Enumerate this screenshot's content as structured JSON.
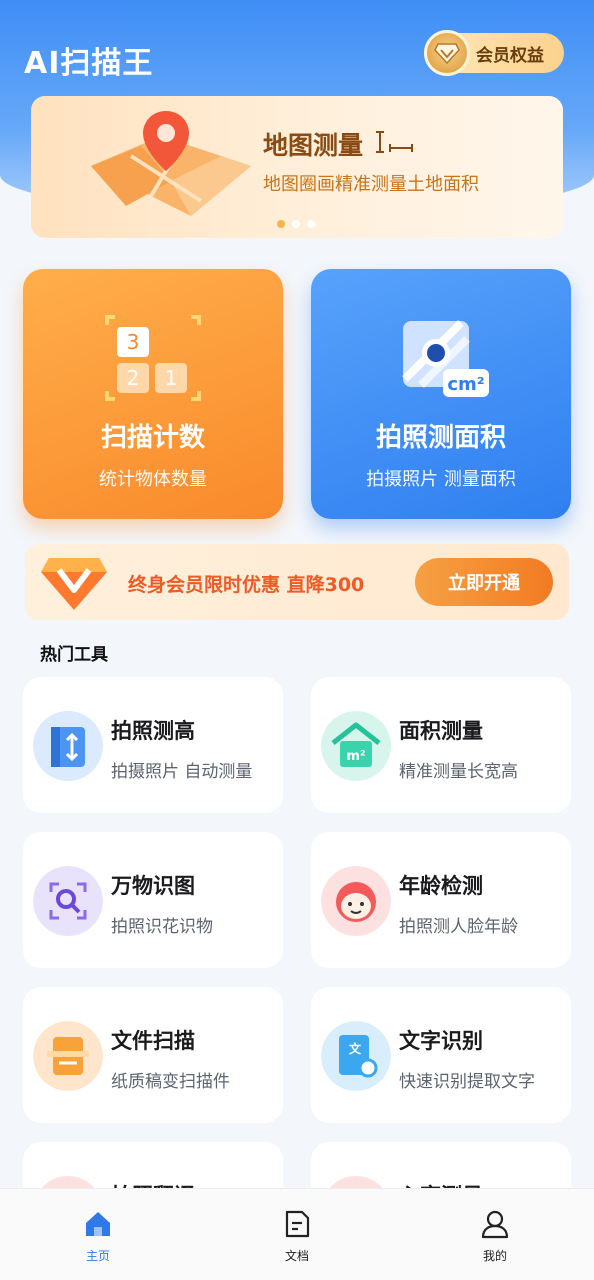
{
  "app": {
    "title": "AI扫描王"
  },
  "header": {
    "vip_label": "会员权益"
  },
  "banner": {
    "title": "地图测量",
    "subtitle": "地图圈画精准测量土地面积",
    "dot_count": 3,
    "active_dot": 0
  },
  "features": [
    {
      "title": "扫描计数",
      "subtitle": "统计物体数量",
      "icon": "counter-blocks-icon",
      "color": "#f98a2b"
    },
    {
      "title": "拍照测面积",
      "subtitle": "拍摄照片 测量面积",
      "icon": "area-measure-icon",
      "color": "#2f7ff0"
    }
  ],
  "promo": {
    "text": "终身会员限时优惠 直降300",
    "button": "立即开通"
  },
  "hot_tools": {
    "title": "热门工具",
    "items": [
      {
        "name": "拍照测高",
        "desc": "拍摄照片 自动测量",
        "icon": "height-ruler-icon"
      },
      {
        "name": "面积测量",
        "desc": "精准测量长宽高",
        "icon": "house-area-icon"
      },
      {
        "name": "万物识图",
        "desc": "拍照识花识物",
        "icon": "image-search-icon"
      },
      {
        "name": "年龄检测",
        "desc": "拍照测人脸年龄",
        "icon": "face-age-icon"
      },
      {
        "name": "文件扫描",
        "desc": "纸质稿变扫描件",
        "icon": "document-scan-icon"
      },
      {
        "name": "文字识别",
        "desc": "快速识别提取文字",
        "icon": "text-recognition-icon"
      },
      {
        "name": "拍照翻译",
        "desc": "",
        "icon": "translate-icon"
      },
      {
        "name": "心率测量",
        "desc": "",
        "icon": "heart-rate-icon"
      }
    ]
  },
  "tabbar": {
    "items": [
      {
        "label": "主页",
        "icon": "home-icon",
        "active": true
      },
      {
        "label": "文档",
        "icon": "document-icon",
        "active": false
      },
      {
        "label": "我的",
        "icon": "user-icon",
        "active": false
      }
    ]
  },
  "colors": {
    "primary": "#2f7ff0",
    "orange": "#f98a2b",
    "promo_text": "#f05a24"
  }
}
